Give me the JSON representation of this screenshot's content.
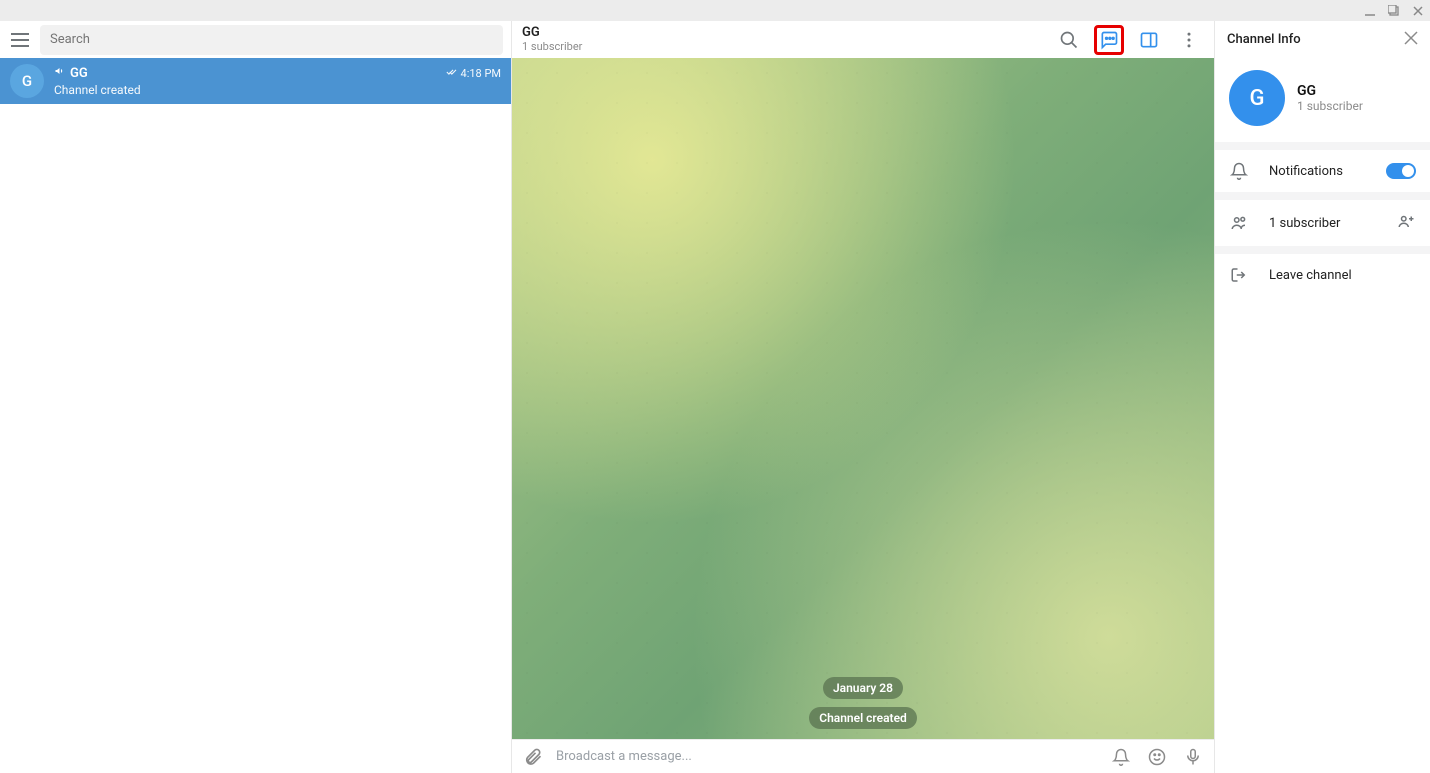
{
  "window": {
    "minimize": "—",
    "maximize": "▢",
    "close": "✕"
  },
  "left": {
    "search_placeholder": "Search",
    "chat": {
      "avatar_letter": "G",
      "name": "GG",
      "subtitle": "Channel created",
      "time": "4:18 PM"
    }
  },
  "header": {
    "title": "GG",
    "subtitle": "1 subscriber"
  },
  "messages": {
    "date_pill": "January 28",
    "service_pill": "Channel created"
  },
  "composer": {
    "placeholder": "Broadcast a message..."
  },
  "panel": {
    "title": "Channel Info",
    "avatar_letter": "G",
    "name": "GG",
    "subscribers": "1 subscriber",
    "notifications_label": "Notifications",
    "subscribers_row": "1 subscriber",
    "leave_label": "Leave channel"
  }
}
